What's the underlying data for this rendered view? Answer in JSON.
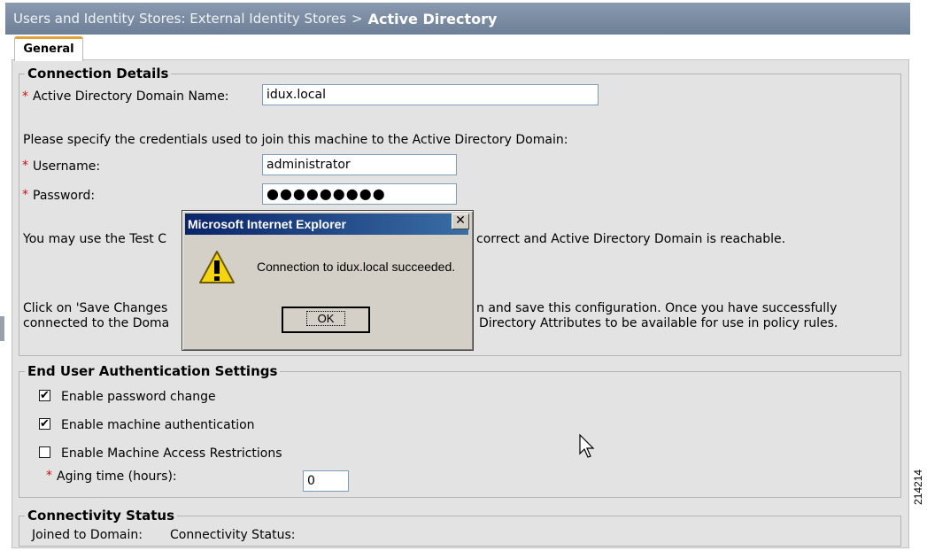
{
  "header": {
    "breadcrumb": "Users and Identity Stores: External Identity Stores",
    "separator": ">",
    "current": "Active Directory"
  },
  "tabs": [
    {
      "label": "General"
    }
  ],
  "connection": {
    "legend": "Connection Details",
    "domain_label": "Active Directory Domain Name:",
    "domain_value": "idux.local",
    "credentials_prompt": "Please specify the credentials used to join this machine to the Active Directory Domain:",
    "username_label": "Username:",
    "username_value": "administrator",
    "password_label": "Password:",
    "password_mask": "●●●●●●●●●",
    "test_text_left": "You may use the Test C",
    "test_text_right": "correct and Active Directory Domain is reachable.",
    "save_text_line1_left": "Click on 'Save Changes",
    "save_text_line1_right": "n and save this configuration. Once you have successfully",
    "save_text_line2_left": "connected to the Doma",
    "save_text_line2_right": "Directory Attributes to be available for use in policy rules."
  },
  "end_user": {
    "legend": "End User Authentication Settings",
    "enable_password_change": "Enable password change",
    "enable_machine_auth": "Enable machine authentication",
    "enable_mar": "Enable Machine Access Restrictions",
    "aging_label": "Aging time (hours):",
    "aging_value": "0",
    "checked_mark": "✔"
  },
  "connectivity": {
    "legend": "Connectivity Status",
    "joined_label": "Joined to Domain:",
    "status_label": "Connectivity Status:"
  },
  "dialog": {
    "title": "Microsoft Internet Explorer",
    "message": "Connection to idux.local succeeded.",
    "ok_label": "OK",
    "close_glyph": "✕",
    "warning_glyph": "!"
  },
  "figure_number": "214214",
  "required_marker": "*"
}
